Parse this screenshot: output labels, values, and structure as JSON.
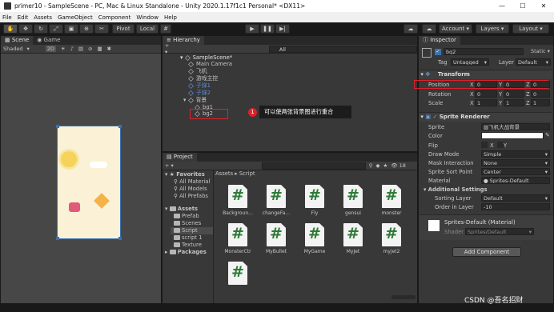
{
  "window": {
    "title": "primer10 - SampleScene - PC, Mac & Linux Standalone - Unity 2020.1.17f1c1 Personal* <DX11>"
  },
  "menu": [
    "File",
    "Edit",
    "Assets",
    "GameObject",
    "Component",
    "Window",
    "Help"
  ],
  "toolbar": {
    "pivot": "Pivot",
    "local": "Local",
    "account": "Account",
    "layers": "Layers",
    "layout": "Layout"
  },
  "scene": {
    "tab_scene": "Scene",
    "tab_game": "Game",
    "shading": "Shaded",
    "mode": "2D"
  },
  "hierarchy": {
    "tab": "Hierarchy",
    "search_placeholder": "All",
    "items": [
      "SampleScene*",
      "Main Camera",
      "飞机",
      "游戏主控",
      "子弹1",
      "子弹2",
      "背景",
      "bg1",
      "bg2"
    ]
  },
  "annotation": {
    "number": "1",
    "text": "可以使两张背景图进行重合"
  },
  "project": {
    "tab": "Project",
    "breadcrumb_root": "Assets",
    "breadcrumb_leaf": "Script",
    "count": "18",
    "tree": [
      "Favorites",
      "All Material",
      "All Models",
      "All Prefabs",
      "Assets",
      "Prefab",
      "Scenes",
      "Script",
      "script 1",
      "Texture",
      "Packages"
    ],
    "assets": [
      "Backgroun...",
      "changeFa...",
      "Fly",
      "gensui",
      "monster",
      "MonsterCtr",
      "MyBullet",
      "MyGame",
      "MyJet",
      "myjet2",
      ""
    ],
    "glyph": "#"
  },
  "inspector": {
    "tab": "Inspector",
    "name": "bg2",
    "static": "Static",
    "tag_label": "Tag",
    "tag": "Untagged",
    "layer_label": "Layer",
    "layer": "Default",
    "transform": "Transform",
    "position": {
      "label": "Position",
      "x": "0",
      "y": "0",
      "z": "0"
    },
    "rotation": {
      "label": "Rotation",
      "x": "0",
      "y": "0",
      "z": "0"
    },
    "scale": {
      "label": "Scale",
      "x": "1",
      "y": "1",
      "z": "1"
    },
    "sprite_renderer": "Sprite Renderer",
    "sprite_label": "Sprite",
    "sprite": "飞机大战背景",
    "color_label": "Color",
    "flip_label": "Flip",
    "flip_x": "X",
    "flip_y": "Y",
    "draw_mode_label": "Draw Mode",
    "draw_mode": "Simple",
    "mask_label": "Mask Interaction",
    "mask": "None",
    "sort_point_label": "Sprite Sort Point",
    "sort_point": "Center",
    "material_label": "Material",
    "material": "Sprites-Default",
    "additional": "Additional Settings",
    "sorting_layer_label": "Sorting Layer",
    "sorting_layer": "Default",
    "order_label": "Order in Layer",
    "order": "-10",
    "mat_title": "Sprites-Default (Material)",
    "shader_label": "Shader",
    "shader": "Sprites/Default",
    "add_component": "Add Component",
    "axis_x": "X",
    "axis_y": "Y",
    "axis_z": "Z"
  },
  "watermark": "CSDN @吾名招财",
  "colors": {
    "highlight_red": "#e0202a",
    "accent_blue": "#3a72b0",
    "green_hash": "#2d7a38"
  }
}
